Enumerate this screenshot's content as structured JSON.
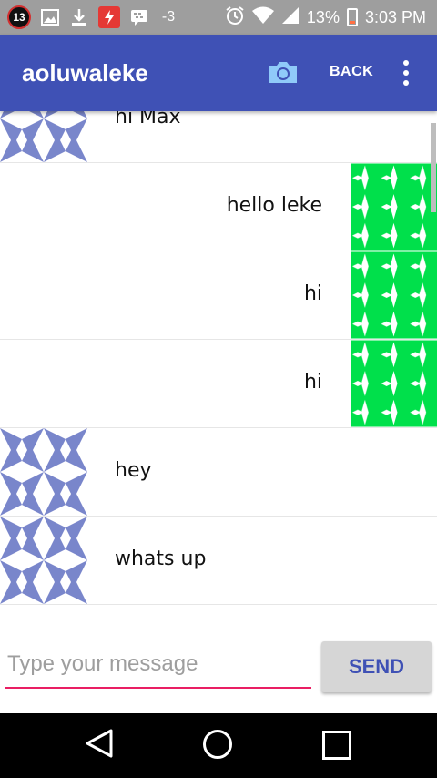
{
  "status_bar": {
    "notification_count": "13",
    "signal_label": "-3",
    "battery_percent": "13%",
    "time": "3:03 PM"
  },
  "app_bar": {
    "title": "aoluwaleke",
    "back_label": "BACK",
    "camera_icon": "camera-icon",
    "more_icon": "more-vert-icon"
  },
  "messages": [
    {
      "side": "left",
      "text": "hi Max",
      "avatar_color": "#7986cb"
    },
    {
      "side": "right",
      "text": "hello leke",
      "avatar_color": "#00e04b"
    },
    {
      "side": "right",
      "text": "hi",
      "avatar_color": "#00e04b"
    },
    {
      "side": "right",
      "text": "hi",
      "avatar_color": "#00e04b"
    },
    {
      "side": "left",
      "text": "hey",
      "avatar_color": "#7986cb"
    },
    {
      "side": "left",
      "text": "whats up",
      "avatar_color": "#7986cb"
    }
  ],
  "composer": {
    "placeholder": "Type your message",
    "send_label": "SEND"
  },
  "colors": {
    "primary": "#3f51b5",
    "accent": "#e91e63"
  }
}
